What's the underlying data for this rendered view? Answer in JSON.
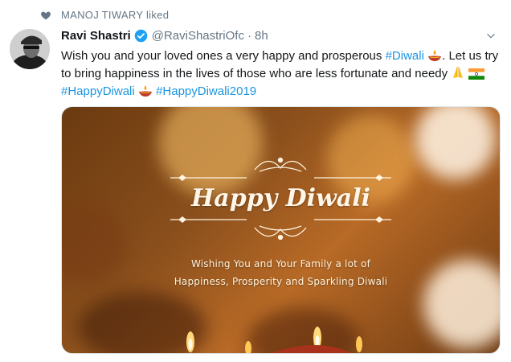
{
  "liked_by": "MANOJ TIWARY liked",
  "tweet": {
    "author_name": "Ravi Shastri",
    "handle": "@RaviShastriOfc",
    "separator": "·",
    "time": "8h",
    "text_1": "Wish you and your loved ones a very happy and prosperous ",
    "hashtag_1": "#Diwali",
    "text_2": ". Let us try to bring happiness in the lives of those who are less fortunate and needy ",
    "hashtag_2": "#HappyDiwali",
    "hashtag_3": "#HappyDiwali2019"
  },
  "media": {
    "title": "Happy Diwali",
    "line_1": "Wishing You and Your Family a lot of",
    "line_2": "Happiness, Prosperity and Sparkling Diwali"
  },
  "icons": {
    "liked": "heart-icon",
    "verified": "verified-badge-icon",
    "caret": "chevron-down-icon",
    "diya": "diya-lamp-emoji",
    "folded_hands": "folded-hands-emoji",
    "flag": "india-flag-emoji"
  },
  "colors": {
    "link": "#1b95e0",
    "secondary_text": "#657786",
    "verified": "#1da1f2"
  }
}
